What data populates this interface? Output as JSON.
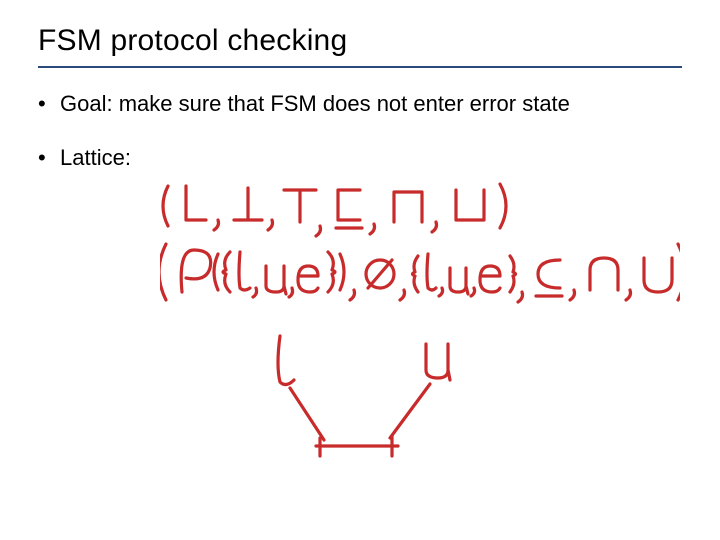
{
  "title": "FSM protocol checking",
  "bullets": [
    "Goal: make sure that FSM does not enter error state",
    "Lattice:"
  ],
  "handwriting": {
    "line1": "( L , ⊥ , ⊤ , ⊑ , ⊓ , ⊔ )",
    "line2": "( 𝒫({ℓ,u,e}) , ∅ , {ℓ,u,e} , ⊆ , ∩ , ∪ )",
    "diagram": {
      "left_label": "ℓ",
      "right_label": "u"
    },
    "color": "#c72b2b"
  }
}
